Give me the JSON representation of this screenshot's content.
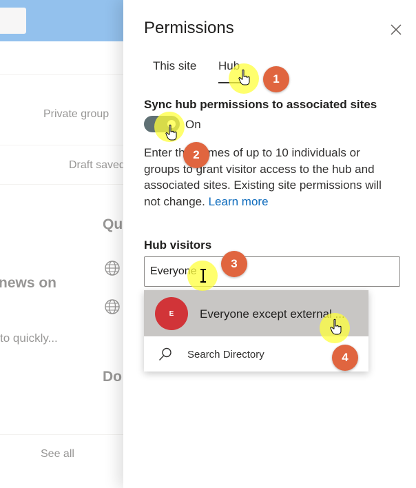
{
  "background": {
    "private_group": "Private group",
    "draft_saved": "Draft saved",
    "heading_q": "Qu",
    "news_on": "news on",
    "to_quickly": "to quickly...",
    "heading_do": "Do",
    "see_all": "See all"
  },
  "panel": {
    "title": "Permissions",
    "tabs": [
      {
        "label": "This site"
      },
      {
        "label": "Hub"
      }
    ],
    "sync_label": "Sync hub permissions to associated sites",
    "toggle_state": "On",
    "description": "Enter the names of up to 10 individuals or groups to grant visitor access to the hub and associated sites. Existing site permissions will not change.",
    "learn_more": "Learn more",
    "hub_visitors_label": "Hub visitors",
    "input_value": "Everyone",
    "suggestion": {
      "initial": "E",
      "name": "Everyone except external ..."
    },
    "search_directory": "Search Directory"
  },
  "callouts": [
    "1",
    "2",
    "3",
    "4"
  ],
  "colors": {
    "accent_badge": "#e0653f",
    "highlight": "#ffff3c",
    "toggle_on": "#5f7074",
    "avatar": "#d13438",
    "link": "#0f6cbd"
  }
}
